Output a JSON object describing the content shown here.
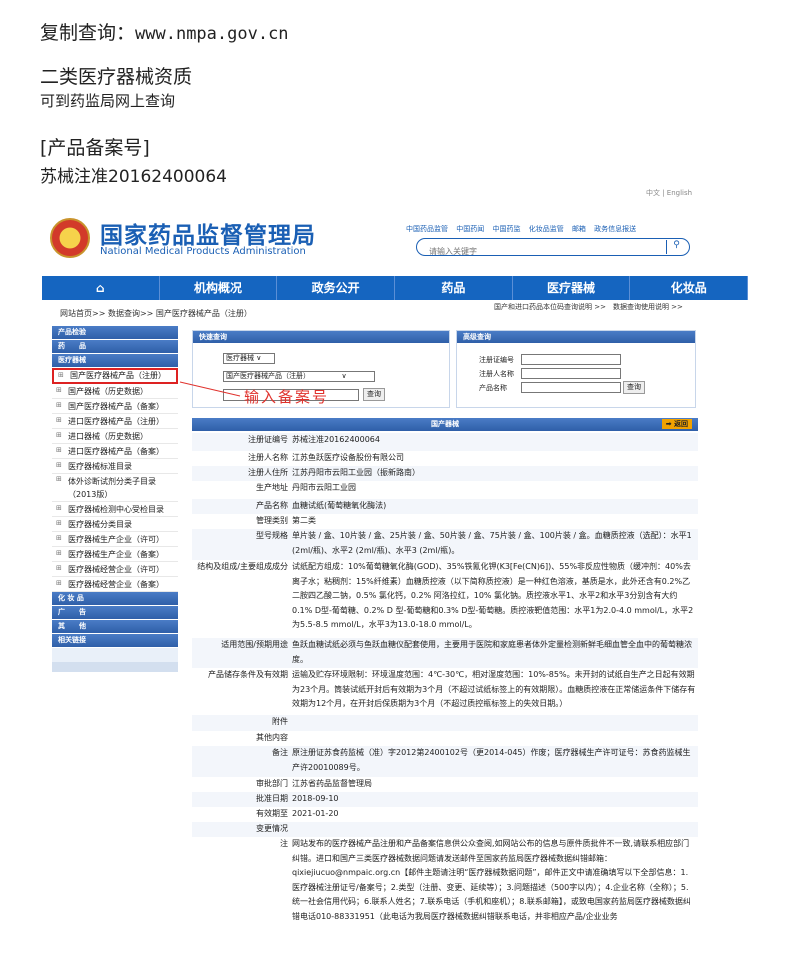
{
  "intro": {
    "line1_label": "复制查询：",
    "line1_url": "www.nmpa.gov.cn",
    "line2": "二类医疗器械资质",
    "line3": "可到药监局网上查询",
    "line4": "[产品备案号]",
    "line5": "苏械注准20162400064"
  },
  "site": {
    "lang": "中文 | English",
    "name_cn": "国家药品监督管理局",
    "name_en": "National Medical Products Administration",
    "toplinks": [
      "中国药品监管",
      "中国药闻",
      "中国药监",
      "化妆品监管",
      "邮箱",
      "政务信息报送"
    ],
    "search_placeholder": "请输入关键字"
  },
  "nav": [
    "⌂",
    "机构概况",
    "政务公开",
    "药品",
    "医疗器械",
    "化妆品"
  ],
  "breadcrumb": "网站首页>> 数据查询>> 国产医疗器械产品（注册）",
  "breadcrumb_right": "国产和进口药品本位码查询说明 >>　数据查询使用说明 >>",
  "sidebar": {
    "cat1": "产品检验",
    "cat2": "药　　品",
    "cat3": "医疗器械",
    "items": [
      "国产医疗器械产品（注册）",
      "国产器械（历史数据）",
      "国产医疗器械产品（备案）",
      "进口医疗器械产品（注册）",
      "进口器械（历史数据）",
      "进口医疗器械产品（备案）",
      "医疗器械标准目录",
      "体外诊断试剂分类子目录（2013版）",
      "医疗器械检测中心受检目录",
      "医疗器械分类目录",
      "医疗器械生产企业（许可）",
      "医疗器械生产企业（备案）",
      "医疗器械经营企业（许可）",
      "医疗器械经营企业（备案）"
    ],
    "cat4": "化 妆 品",
    "cat5": "广　　告",
    "cat6": "其　　他",
    "cat7": "相关链接"
  },
  "quick": {
    "title": "快速查询",
    "select1": "医疗器械 ∨",
    "select2": "国产医疗器械产品（注册）　　　　　∨",
    "button": "查询"
  },
  "advanced": {
    "title": "高级查询",
    "f1": "注册证编号",
    "f2": "注册人名称",
    "f3": "产品名称",
    "button": "查询"
  },
  "callout": "输入备案号",
  "detail": {
    "title": "国产器械",
    "back": "➡ 返回",
    "rows": [
      {
        "label": "注册证编号",
        "value": "苏械注准20162400064"
      },
      {
        "label": "注册人名称",
        "value": "江苏鱼跃医疗设备股份有限公司"
      },
      {
        "label": "注册人住所",
        "value": "江苏丹阳市云阳工业园（振新路南）"
      },
      {
        "label": "生产地址",
        "value": "丹阳市云阳工业园"
      },
      {
        "label": "产品名称",
        "value": "血糖试纸(葡萄糖氧化酶法)"
      },
      {
        "label": "管理类别",
        "value": "第二类"
      },
      {
        "label": "型号规格",
        "value": "单片装 / 盒、10片装 / 盒、25片装 / 盒、50片装 / 盒、75片装 / 盒、100片装 / 盒。血糖质控液（选配）：水平1 (2ml/瓶)、水平2 (2ml/瓶)、水平3 (2ml/瓶)。"
      },
      {
        "label": "结构及组成/主要组成成分",
        "value": "试纸配方组成：10%葡萄糖氧化酶(GOD)、35%铁氰化钾(K3[Fe(CN)6])、55%非反应性物质（缓冲剂：40%去离子水；粘稠剂：15%纤维素）血糖质控液（以下简称质控液）是一种红色溶液，基质是水，此外还含有0.2%乙二胺四乙酸二钠，0.5% 氯化钙，0.2% 阿洛拉红，10% 氯化钠。质控液水平1、水平2和水平3分别含有大约0.1% D型-葡萄糖、0.2% D 型-葡萄糖和0.3% D型-葡萄糖。质控液靶值范围：水平1为2.0-4.0 mmol/L，水平2为5.5-8.5 mmol/L，水平3为13.0-18.0 mmol/L。"
      },
      {
        "label": "适用范围/预期用途",
        "value": "鱼跃血糖试纸必须与鱼跃血糖仪配套使用，主要用于医院和家庭患者体外定量检测新鲜毛细血管全血中的葡萄糖浓度。"
      },
      {
        "label": "产品储存条件及有效期",
        "value": "运输及贮存环境限制：环境温度范围：4℃-30℃，相对湿度范围：10%-85%。未开封的试纸自生产之日起有效期为23个月。筒装试纸开封后有效期为3个月（不超过试纸标签上的有效期限）。血糖质控液在正常储运条件下储存有效期为12个月，在开封后保质期为3个月（不超过质控瓶标签上的失效日期。）"
      },
      {
        "label": "附件",
        "value": ""
      },
      {
        "label": "其他内容",
        "value": ""
      },
      {
        "label": "备注",
        "value": "原注册证苏食药监械（准）字2012第2400102号（更2014-045）作废；医疗器械生产许可证号：苏食药监械生产许20010089号。"
      },
      {
        "label": "审批部门",
        "value": "江苏省药品监督管理局"
      },
      {
        "label": "批准日期",
        "value": "2018-09-10"
      },
      {
        "label": "有效期至",
        "value": "2021-01-20"
      },
      {
        "label": "变更情况",
        "value": ""
      },
      {
        "label": "注",
        "value": "网站发布的医疗器械产品注册和产品备案信息供公众查阅,如网站公布的信息与原件质批件不一致,请联系相应部门纠错。进口和国产三类医疗器械数据问题请发送邮件至国家药监局医疗器械数据纠错邮箱：qixiejiucuo@nmpaic.org.cn【邮件主题请注明“医疗器械数据问题”，邮件正文中请准确填写以下全部信息：1.医疗器械注册证号/备案号；2.类型（注册、变更、延续等）；3.问题描述（500字以内）；4.企业名称（全称）；5.统一社会信用代码；6.联系人姓名；7.联系电话（手机和座机）；8.联系邮箱】，或致电国家药监局医疗器械数据纠错电话010-88331951（此电话为我局医疗器械数据纠错联系电话，并非相应产品/企业业务"
      }
    ]
  }
}
